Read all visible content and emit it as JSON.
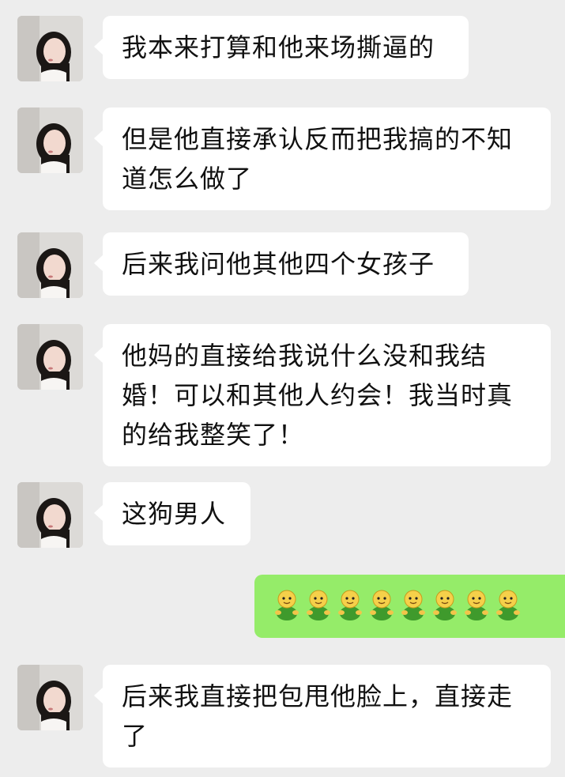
{
  "messages": [
    {
      "side": "left",
      "text": "我本来打算和他来场撕逼的"
    },
    {
      "side": "left",
      "text": "但是他直接承认反而把我搞的不知道怎么做了"
    },
    {
      "side": "left",
      "text": "后来我问他其他四个女孩子"
    },
    {
      "side": "left",
      "text": "他妈的直接给我说什么没和我结婚！可以和其他人约会！我当时真的给我整笑了！"
    },
    {
      "side": "left",
      "text": "这狗男人"
    },
    {
      "side": "right",
      "emoji": "doge-green-emoji",
      "count": 8
    },
    {
      "side": "left",
      "text": "后来我直接把包甩他脸上，直接走了"
    }
  ],
  "colors": {
    "background": "#ededed",
    "incoming_bubble": "#ffffff",
    "outgoing_bubble": "#95ec69"
  }
}
